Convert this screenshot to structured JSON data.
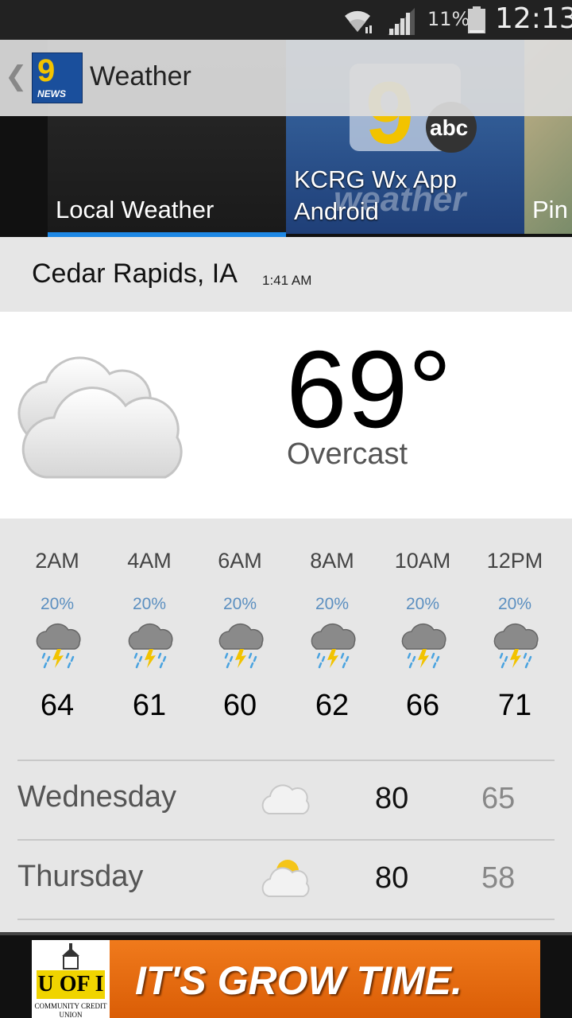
{
  "status_bar": {
    "battery_percent": "11%",
    "time": "12:13",
    "icons": [
      "wifi-icon",
      "signal-icon",
      "battery-icon"
    ]
  },
  "action_bar": {
    "title": "Weather",
    "logo_text": "9",
    "logo_subtext": "NEWS"
  },
  "tabs": [
    {
      "label": "Local Weather",
      "selected": true
    },
    {
      "label_line1": "KCRG Wx App",
      "label_line2": "Android",
      "watermark": "weather"
    },
    {
      "label": "Pin"
    }
  ],
  "location": {
    "city": "Cedar Rapids, IA",
    "updated": "1:41 AM"
  },
  "current": {
    "temperature": "69°",
    "condition": "Overcast",
    "icon": "overcast-icon"
  },
  "hourly": [
    {
      "time": "2AM",
      "precip": "20%",
      "temp": "64",
      "icon": "thunderstorm-icon"
    },
    {
      "time": "4AM",
      "precip": "20%",
      "temp": "61",
      "icon": "thunderstorm-icon"
    },
    {
      "time": "6AM",
      "precip": "20%",
      "temp": "60",
      "icon": "thunderstorm-icon"
    },
    {
      "time": "8AM",
      "precip": "20%",
      "temp": "62",
      "icon": "thunderstorm-icon"
    },
    {
      "time": "10AM",
      "precip": "20%",
      "temp": "66",
      "icon": "thunderstorm-icon"
    },
    {
      "time": "12PM",
      "precip": "20%",
      "temp": "71",
      "icon": "thunderstorm-icon"
    }
  ],
  "daily": [
    {
      "day": "Wednesday",
      "high": "80",
      "low": "65",
      "icon": "cloudy-icon"
    },
    {
      "day": "Thursday",
      "high": "80",
      "low": "58",
      "icon": "partly-sunny-icon"
    }
  ],
  "ad": {
    "slogan": "IT'S GROW TIME.",
    "logo_text": "U OF I",
    "logo_subtext": "COMMUNITY CREDIT UNION"
  },
  "colors": {
    "tab_indicator": "#1e88e5",
    "precip_text": "#5b8fc0",
    "ad_orange": "#e8690f"
  }
}
